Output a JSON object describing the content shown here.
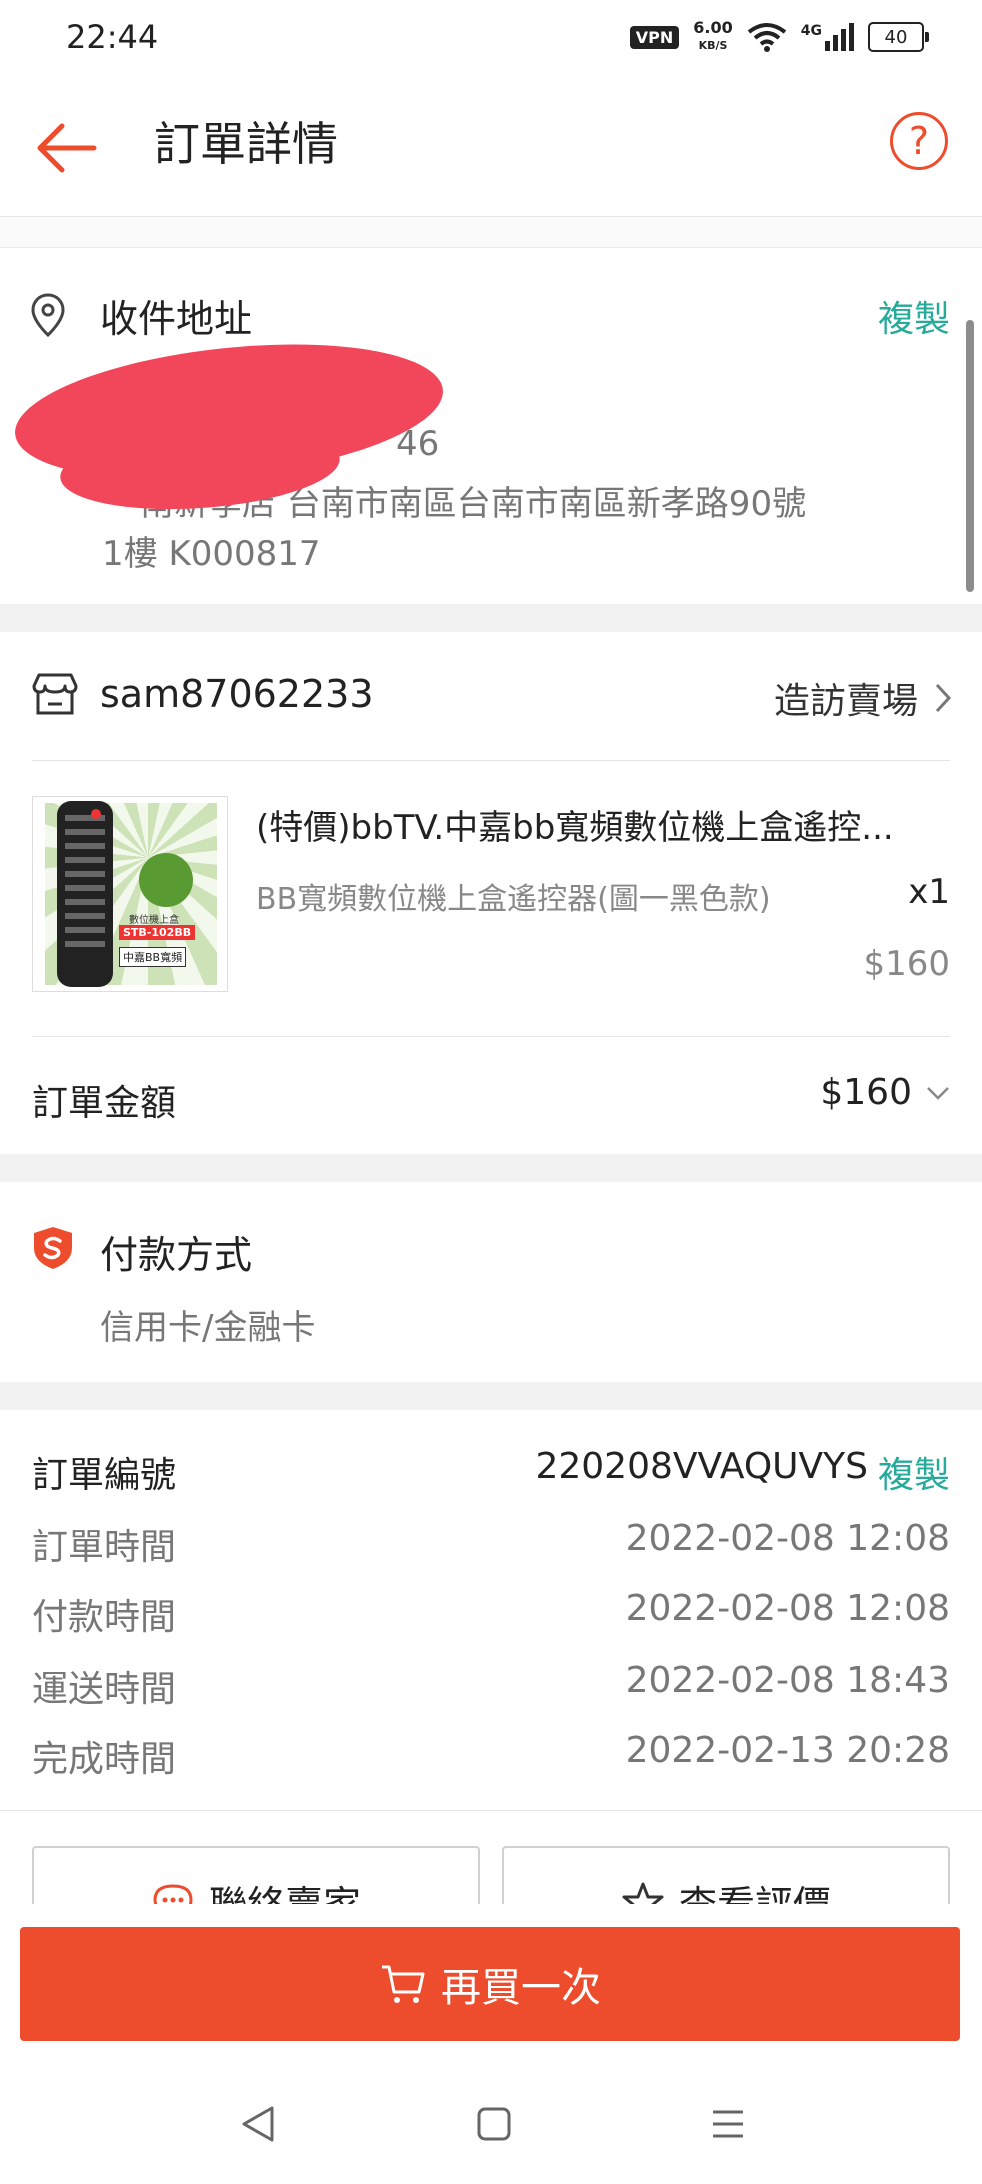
{
  "status_bar": {
    "time": "22:44",
    "vpn": "VPN",
    "speed_value": "6.00",
    "speed_unit": "KB/S",
    "network": "4G",
    "battery": "40"
  },
  "header": {
    "title": "訂單詳情"
  },
  "address": {
    "title": "收件地址",
    "copy_label": "複製",
    "phone_partial": "46",
    "line1": "南新孝店 台南市南區台南市南區新孝路90號",
    "line2": "1樓 K000817"
  },
  "shop": {
    "name": "sam87062233",
    "visit_label": "造訪賣場"
  },
  "product": {
    "title": "(特價)bbTV.中嘉bb寬頻數位機上盒遙控...",
    "variation": "BB寬頻數位機上盒遙控器(圖一黑色款)",
    "quantity": "x1",
    "price": "$160",
    "image_label_model": "STB-102BB",
    "image_label_top": "數位機上盒",
    "image_label_box": "中嘉BB寬頻"
  },
  "order_total": {
    "label": "訂單金額",
    "value": "$160"
  },
  "payment": {
    "title": "付款方式",
    "method": "信用卡/金融卡"
  },
  "order_info": {
    "number_label": "訂單編號",
    "number_value": "220208VVAQUVYS",
    "copy_label": "複製",
    "rows": [
      {
        "label": "訂單時間",
        "value": "2022-02-08 12:08"
      },
      {
        "label": "付款時間",
        "value": "2022-02-08 12:08"
      },
      {
        "label": "運送時間",
        "value": "2022-02-08 18:43"
      },
      {
        "label": "完成時間",
        "value": "2022-02-13 20:28"
      }
    ]
  },
  "actions": {
    "contact_label": "聯絡賣家",
    "review_label": "查看評價"
  },
  "buy_again": {
    "label": "再買一次"
  },
  "colors": {
    "accent": "#ee4d2d",
    "teal": "#26aa99"
  }
}
